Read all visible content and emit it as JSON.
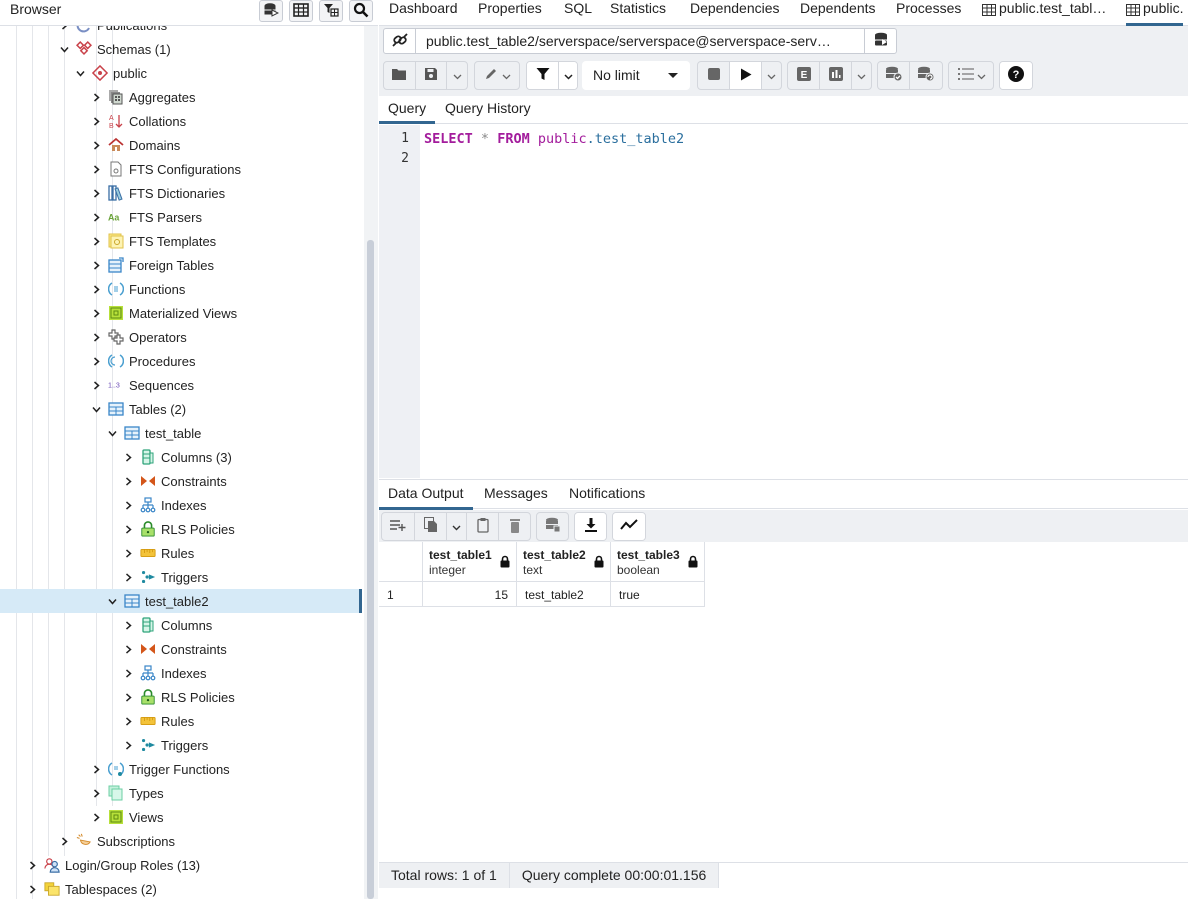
{
  "browser": {
    "title": "Browser",
    "header_buttons": [
      {
        "name": "query-tool-icon"
      },
      {
        "name": "view-data-icon"
      },
      {
        "name": "filtered-rows-icon"
      },
      {
        "name": "search-objects-icon"
      }
    ],
    "tree": [
      {
        "label": "Publications",
        "level": 4,
        "expanded": false,
        "icon": "publications-icon"
      },
      {
        "label": "Schemas (1)",
        "level": 4,
        "expanded": true,
        "icon": "schemas-icon"
      },
      {
        "label": "public",
        "level": 5,
        "expanded": true,
        "icon": "schema-icon"
      },
      {
        "label": "Aggregates",
        "level": 6,
        "expanded": false,
        "icon": "aggregates-icon"
      },
      {
        "label": "Collations",
        "level": 6,
        "expanded": false,
        "icon": "collations-icon"
      },
      {
        "label": "Domains",
        "level": 6,
        "expanded": false,
        "icon": "domains-icon"
      },
      {
        "label": "FTS Configurations",
        "level": 6,
        "expanded": false,
        "icon": "fts-configurations-icon"
      },
      {
        "label": "FTS Dictionaries",
        "level": 6,
        "expanded": false,
        "icon": "fts-dictionaries-icon"
      },
      {
        "label": "FTS Parsers",
        "level": 6,
        "expanded": false,
        "icon": "fts-parsers-icon"
      },
      {
        "label": "FTS Templates",
        "level": 6,
        "expanded": false,
        "icon": "fts-templates-icon"
      },
      {
        "label": "Foreign Tables",
        "level": 6,
        "expanded": false,
        "icon": "foreign-tables-icon"
      },
      {
        "label": "Functions",
        "level": 6,
        "expanded": false,
        "icon": "functions-icon"
      },
      {
        "label": "Materialized Views",
        "level": 6,
        "expanded": false,
        "icon": "materialized-views-icon"
      },
      {
        "label": "Operators",
        "level": 6,
        "expanded": false,
        "icon": "operators-icon"
      },
      {
        "label": "Procedures",
        "level": 6,
        "expanded": false,
        "icon": "procedures-icon"
      },
      {
        "label": "Sequences",
        "level": 6,
        "expanded": false,
        "icon": "sequences-icon"
      },
      {
        "label": "Tables (2)",
        "level": 6,
        "expanded": true,
        "icon": "tables-icon"
      },
      {
        "label": "test_table",
        "level": 7,
        "expanded": true,
        "icon": "table-icon"
      },
      {
        "label": "Columns (3)",
        "level": 8,
        "expanded": false,
        "icon": "columns-icon"
      },
      {
        "label": "Constraints",
        "level": 8,
        "expanded": false,
        "icon": "constraints-icon"
      },
      {
        "label": "Indexes",
        "level": 8,
        "expanded": false,
        "icon": "indexes-icon"
      },
      {
        "label": "RLS Policies",
        "level": 8,
        "expanded": false,
        "icon": "rls-policies-icon"
      },
      {
        "label": "Rules",
        "level": 8,
        "expanded": false,
        "icon": "rules-icon"
      },
      {
        "label": "Triggers",
        "level": 8,
        "expanded": false,
        "icon": "triggers-icon"
      },
      {
        "label": "test_table2",
        "level": 7,
        "expanded": true,
        "icon": "table-icon",
        "selected": true
      },
      {
        "label": "Columns",
        "level": 8,
        "expanded": false,
        "icon": "columns-icon"
      },
      {
        "label": "Constraints",
        "level": 8,
        "expanded": false,
        "icon": "constraints-icon"
      },
      {
        "label": "Indexes",
        "level": 8,
        "expanded": false,
        "icon": "indexes-icon"
      },
      {
        "label": "RLS Policies",
        "level": 8,
        "expanded": false,
        "icon": "rls-policies-icon"
      },
      {
        "label": "Rules",
        "level": 8,
        "expanded": false,
        "icon": "rules-icon"
      },
      {
        "label": "Triggers",
        "level": 8,
        "expanded": false,
        "icon": "triggers-icon"
      },
      {
        "label": "Trigger Functions",
        "level": 6,
        "expanded": false,
        "icon": "trigger-functions-icon"
      },
      {
        "label": "Types",
        "level": 6,
        "expanded": false,
        "icon": "types-icon"
      },
      {
        "label": "Views",
        "level": 6,
        "expanded": false,
        "icon": "views-icon"
      },
      {
        "label": "Subscriptions",
        "level": 4,
        "expanded": false,
        "icon": "subscriptions-icon"
      },
      {
        "label": "Login/Group Roles (13)",
        "level": 2,
        "expanded": false,
        "icon": "login-roles-icon"
      },
      {
        "label": "Tablespaces (2)",
        "level": 2,
        "expanded": false,
        "icon": "tablespaces-icon"
      }
    ]
  },
  "tabs": [
    {
      "label": "Dashboard",
      "active": false
    },
    {
      "label": "Properties",
      "active": false
    },
    {
      "label": "SQL",
      "active": false
    },
    {
      "label": "Statistics",
      "active": false
    },
    {
      "label": "Dependencies",
      "active": false
    },
    {
      "label": "Dependents",
      "active": false
    },
    {
      "label": "Processes",
      "active": false
    },
    {
      "label": "public.test_tabl…",
      "active": false,
      "icon": "table-icon"
    },
    {
      "label": "public.",
      "active": true,
      "icon": "table-icon"
    }
  ],
  "query_tool": {
    "connection": "public.test_table2/serverspace/serverspace@serverspace-serv…",
    "limit": "No limit",
    "query_tabs": [
      {
        "label": "Query",
        "active": true
      },
      {
        "label": "Query History",
        "active": false
      }
    ],
    "editor": {
      "line_numbers": [
        "1",
        "2"
      ],
      "code": {
        "kw1": "SELECT",
        "star": "*",
        "kw2": "FROM",
        "schema": "public",
        "dot": ".",
        "table": "test_table2"
      }
    }
  },
  "output": {
    "tabs": [
      {
        "label": "Data Output",
        "active": true
      },
      {
        "label": "Messages",
        "active": false
      },
      {
        "label": "Notifications",
        "active": false
      }
    ],
    "columns": [
      {
        "name": "test_table1",
        "type": "integer"
      },
      {
        "name": "test_table2",
        "type": "text"
      },
      {
        "name": "test_table3",
        "type": "boolean"
      }
    ],
    "rows": [
      {
        "index": "1",
        "cells": [
          "15",
          "test_table2",
          "true"
        ]
      }
    ],
    "status": {
      "total_rows": "Total rows: 1 of 1",
      "query_complete": "Query complete 00:00:01.156"
    }
  },
  "colors": {
    "accent": "#326690",
    "selected_bg": "#d6eaf7",
    "keyword": "#a31c9c",
    "table_ident": "#2b6f9e",
    "toolbar_bg": "#eef0f3"
  }
}
